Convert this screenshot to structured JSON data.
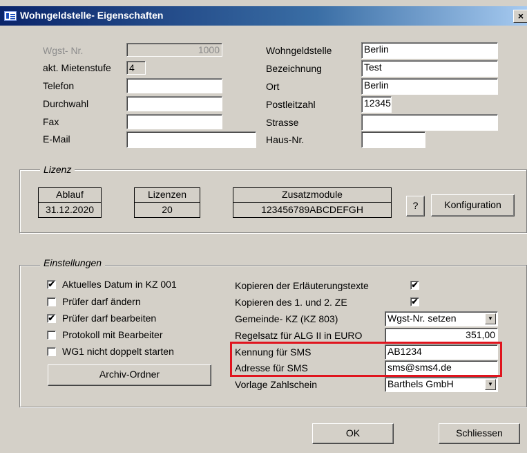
{
  "window": {
    "title": "Wohngeldstelle- Eigenschaften",
    "close": "×"
  },
  "fields": {
    "wgst_nr": {
      "label": "Wgst- Nr.",
      "value": "1000"
    },
    "mietenstufe": {
      "label": "akt. Mietenstufe",
      "value": "4"
    },
    "telefon": {
      "label": "Telefon",
      "value": ""
    },
    "durchwahl": {
      "label": "Durchwahl",
      "value": ""
    },
    "fax": {
      "label": "Fax",
      "value": ""
    },
    "email": {
      "label": "E-Mail",
      "value": ""
    },
    "wohngeldstelle": {
      "label": "Wohngeldstelle",
      "value": "Berlin"
    },
    "bezeichnung": {
      "label": "Bezeichnung",
      "value": "Test"
    },
    "ort": {
      "label": "Ort",
      "value": "Berlin"
    },
    "plz": {
      "label": "Postleitzahl",
      "value": "12345"
    },
    "strasse": {
      "label": "Strasse",
      "value": ""
    },
    "hausnr": {
      "label": "Haus-Nr.",
      "value": ""
    }
  },
  "lizenz": {
    "caption": "Lizenz",
    "ablauf": {
      "header": "Ablauf",
      "value": "31.12.2020"
    },
    "lizenzen": {
      "header": "Lizenzen",
      "value": "20"
    },
    "zusatzmodule": {
      "header": "Zusatzmodule",
      "value": "123456789ABCDEFGH"
    },
    "help_button": "?",
    "config_button": "Konfiguration"
  },
  "einstellungen": {
    "caption": "Einstellungen",
    "checks_left": [
      {
        "label": "Aktuelles Datum in KZ 001",
        "checked": true,
        "mark": "✔"
      },
      {
        "label": "Prüfer darf ändern",
        "checked": false,
        "mark": ""
      },
      {
        "label": "Prüfer darf bearbeiten",
        "checked": true,
        "mark": "✔"
      },
      {
        "label": "Protokoll mit Bearbeiter",
        "checked": false,
        "mark": ""
      },
      {
        "label": "WG1 nicht doppelt starten",
        "checked": false,
        "mark": ""
      }
    ],
    "archiv_button": "Archiv-Ordner",
    "kopieren_erlaeuterung": {
      "label": "Kopieren der Erläuterungstexte",
      "mark": "✔"
    },
    "kopieren_ze": {
      "label": "Kopieren des 1. und 2. ZE",
      "mark": "✔"
    },
    "gemeinde_kz": {
      "label": "Gemeinde- KZ (KZ 803)",
      "value": "Wgst-Nr. setzen"
    },
    "regelsatz": {
      "label": "Regelsatz für ALG II in EURO",
      "value": "351,00"
    },
    "kennung_sms": {
      "label": "Kennung für SMS",
      "value": "AB1234"
    },
    "adresse_sms": {
      "label": "Adresse für SMS",
      "value": "sms@sms4.de"
    },
    "vorlage": {
      "label": "Vorlage Zahlschein",
      "value": "Barthels GmbH"
    }
  },
  "buttons": {
    "ok": "OK",
    "close": "Schliessen"
  },
  "colors": {
    "highlight": "#e0141e",
    "titlebar": "#0a246a"
  }
}
